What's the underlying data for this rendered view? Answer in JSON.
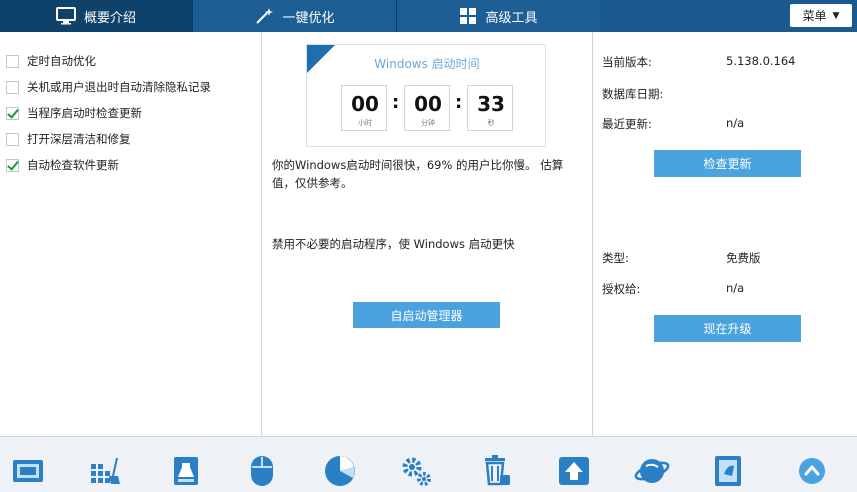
{
  "tabs": [
    {
      "label": "概要介绍",
      "icon": "monitor-icon"
    },
    {
      "label": "一键优化",
      "icon": "magic-wand-icon"
    },
    {
      "label": "高级工具",
      "icon": "grid-icon"
    }
  ],
  "menu": {
    "label": "菜单",
    "icon": "chevron-down-icon"
  },
  "options": [
    {
      "label": "定时自动优化",
      "checked": false
    },
    {
      "label": "关机或用户退出时自动清除隐私记录",
      "checked": false
    },
    {
      "label": "当程序启动时检查更新",
      "checked": true
    },
    {
      "label": "打开深层清洁和修复",
      "checked": false
    },
    {
      "label": "自动检查软件更新",
      "checked": true
    }
  ],
  "boot_timer": {
    "title": "Windows 启动时间",
    "hours": "00",
    "hours_unit": "小时",
    "minutes": "00",
    "minutes_unit": "分钟",
    "seconds": "33",
    "seconds_unit": "秒"
  },
  "middle": {
    "info_text": "你的Windows启动时间很快，69% 的用户比你慢。 估算值，仅供参考。",
    "tip_text": "禁用不必要的启动程序，使 Windows 启动更快",
    "startup_manager_button": "自启动管理器"
  },
  "info": {
    "current_version_label": "当前版本:",
    "current_version_value": "5.138.0.164",
    "db_date_label": "数据库日期:",
    "db_date_value": "",
    "last_update_label": "最近更新:",
    "last_update_value": "n/a",
    "check_update_button": "检查更新",
    "type_label": "类型:",
    "type_value": "免费版",
    "license_label": "授权给:",
    "license_value": "n/a",
    "upgrade_button": "现在升级"
  },
  "toolbar_icons": [
    "screen-icon",
    "registry-cleaner-icon",
    "disk-cleaner-icon",
    "mouse-icon",
    "disk-usage-icon",
    "settings-gears-icon",
    "uninstall-icon",
    "upload-icon",
    "internet-icon",
    "system-info-icon",
    "up-arrow-icon"
  ],
  "colors": {
    "header": "#1a5a8e",
    "active_tab": "#0f426b",
    "accent_button": "#4aa3df",
    "toolbar_icon": "#2b7fc4"
  }
}
